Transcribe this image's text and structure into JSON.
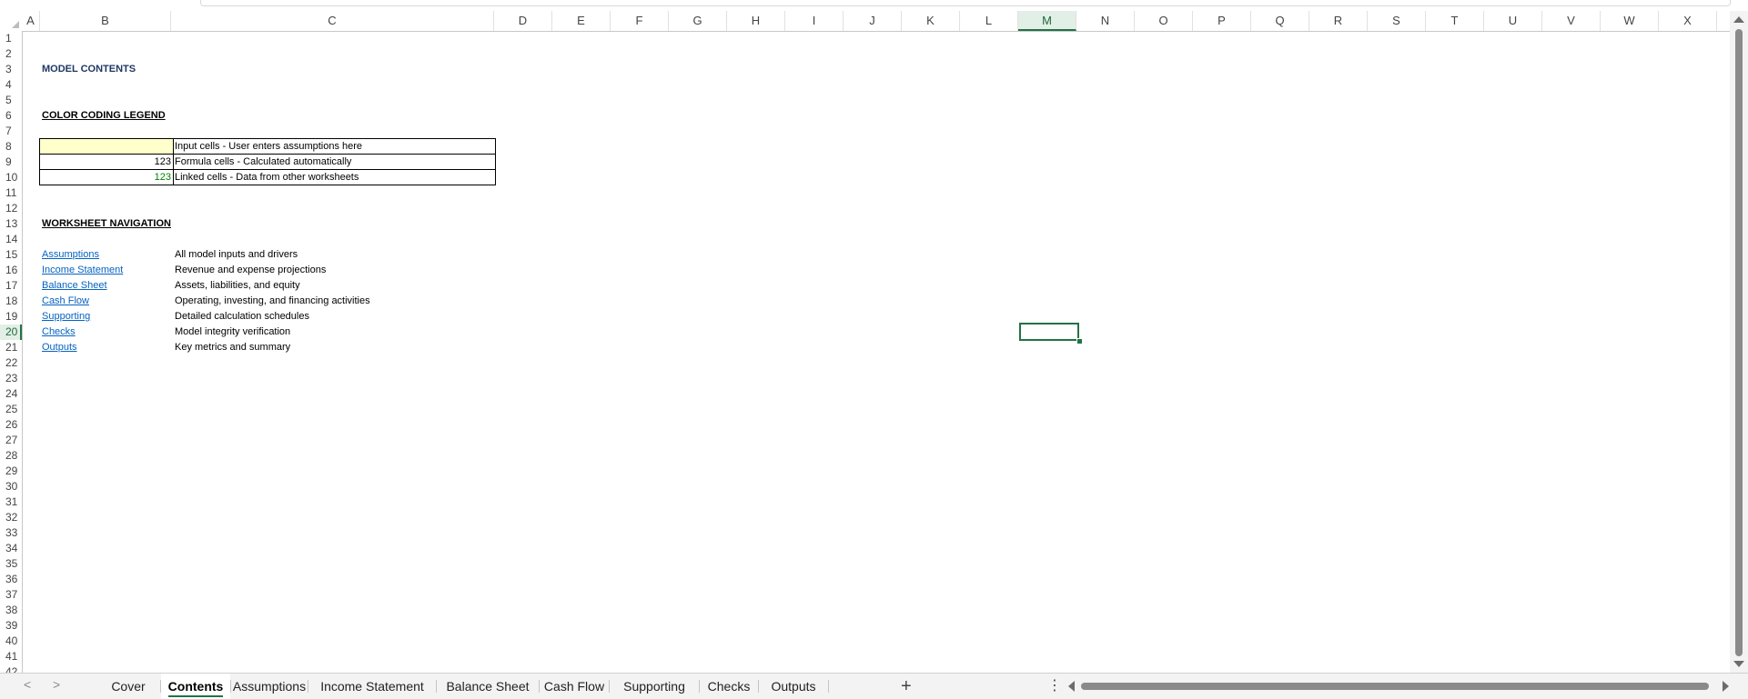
{
  "columns": [
    "A",
    "B",
    "C",
    "D",
    "E",
    "F",
    "G",
    "H",
    "I",
    "J",
    "K",
    "L",
    "M",
    "N",
    "O",
    "P",
    "Q",
    "R",
    "S",
    "T",
    "U",
    "V",
    "W",
    "X"
  ],
  "selected_column": "M",
  "rows": [
    "1",
    "2",
    "3",
    "4",
    "5",
    "6",
    "7",
    "8",
    "9",
    "10",
    "11",
    "12",
    "13",
    "14",
    "15",
    "16",
    "17",
    "18",
    "19",
    "20",
    "21",
    "22",
    "23",
    "24",
    "25",
    "26",
    "27",
    "28",
    "29",
    "30",
    "31",
    "32",
    "33",
    "34",
    "35",
    "36",
    "37",
    "38",
    "39",
    "40",
    "41",
    "42"
  ],
  "selected_row": "20",
  "sheet": {
    "title": "MODEL CONTENTS",
    "legend_heading": "COLOR CODING LEGEND",
    "legend": [
      {
        "sample": "",
        "label": "Input cells - User enters assumptions here"
      },
      {
        "sample": "123",
        "label": "Formula cells - Calculated automatically"
      },
      {
        "sample": "123",
        "label": "Linked cells - Data from other worksheets"
      }
    ],
    "nav_heading": "WORKSHEET NAVIGATION",
    "nav": [
      {
        "link": "Assumptions",
        "desc": "All model inputs and drivers"
      },
      {
        "link": "Income Statement",
        "desc": "Revenue and expense projections"
      },
      {
        "link": "Balance Sheet",
        "desc": "Assets, liabilities, and equity"
      },
      {
        "link": "Cash Flow",
        "desc": "Operating, investing, and financing activities"
      },
      {
        "link": "Supporting",
        "desc": "Detailed calculation schedules"
      },
      {
        "link": "Checks",
        "desc": "Model integrity verification"
      },
      {
        "link": "Outputs",
        "desc": "Key metrics and summary"
      }
    ]
  },
  "tabs": [
    "Cover",
    "Contents",
    "Assumptions",
    "Income Statement",
    "Balance Sheet",
    "Cash Flow",
    "Supporting",
    "Checks",
    "Outputs"
  ],
  "active_tab": "Contents",
  "tabbar": {
    "prev": "<",
    "next": ">",
    "add": "+",
    "more": "⋮"
  },
  "colors": {
    "accent": "#217346",
    "link": "#0563c1",
    "input_fill": "#ffffcc",
    "linked_text": "#008000",
    "title": "#1f3864"
  }
}
